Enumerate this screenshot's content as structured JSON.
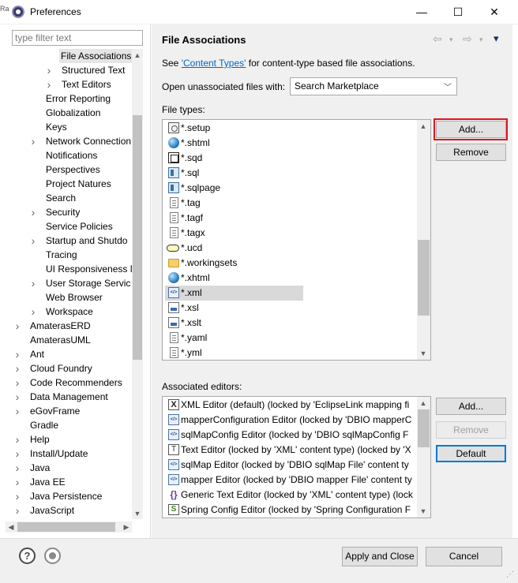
{
  "window": {
    "title": "Preferences",
    "edge_mark": "Ra",
    "minimize": "—",
    "maximize": "☐",
    "close": "✕"
  },
  "sidebar": {
    "filter_placeholder": "type filter text",
    "items": [
      {
        "label": "File Associations",
        "depth": 3,
        "twisty": "",
        "selected": true
      },
      {
        "label": "Structured Text",
        "depth": 2,
        "twisty": ">"
      },
      {
        "label": "Text Editors",
        "depth": 2,
        "twisty": ">"
      },
      {
        "label": "Error Reporting",
        "depth": 1,
        "twisty": ""
      },
      {
        "label": "Globalization",
        "depth": 1,
        "twisty": ""
      },
      {
        "label": "Keys",
        "depth": 1,
        "twisty": ""
      },
      {
        "label": "Network Connection",
        "depth": 1,
        "twisty": ">"
      },
      {
        "label": "Notifications",
        "depth": 1,
        "twisty": ""
      },
      {
        "label": "Perspectives",
        "depth": 1,
        "twisty": ""
      },
      {
        "label": "Project Natures",
        "depth": 1,
        "twisty": ""
      },
      {
        "label": "Search",
        "depth": 1,
        "twisty": ""
      },
      {
        "label": "Security",
        "depth": 1,
        "twisty": ">"
      },
      {
        "label": "Service Policies",
        "depth": 1,
        "twisty": ""
      },
      {
        "label": "Startup and Shutdo",
        "depth": 1,
        "twisty": ">"
      },
      {
        "label": "Tracing",
        "depth": 1,
        "twisty": ""
      },
      {
        "label": "UI Responsiveness M",
        "depth": 1,
        "twisty": ""
      },
      {
        "label": "User Storage Servic",
        "depth": 1,
        "twisty": ">"
      },
      {
        "label": "Web Browser",
        "depth": 1,
        "twisty": ""
      },
      {
        "label": "Workspace",
        "depth": 1,
        "twisty": ">"
      },
      {
        "label": "AmaterasERD",
        "depth": 0,
        "twisty": ">"
      },
      {
        "label": "AmaterasUML",
        "depth": 0,
        "twisty": ""
      },
      {
        "label": "Ant",
        "depth": 0,
        "twisty": ">"
      },
      {
        "label": "Cloud Foundry",
        "depth": 0,
        "twisty": ">"
      },
      {
        "label": "Code Recommenders",
        "depth": 0,
        "twisty": ">"
      },
      {
        "label": "Data Management",
        "depth": 0,
        "twisty": ">"
      },
      {
        "label": "eGovFrame",
        "depth": 0,
        "twisty": ">"
      },
      {
        "label": "Gradle",
        "depth": 0,
        "twisty": ""
      },
      {
        "label": "Help",
        "depth": 0,
        "twisty": ">"
      },
      {
        "label": "Install/Update",
        "depth": 0,
        "twisty": ">"
      },
      {
        "label": "Java",
        "depth": 0,
        "twisty": ">"
      },
      {
        "label": "Java EE",
        "depth": 0,
        "twisty": ">"
      },
      {
        "label": "Java Persistence",
        "depth": 0,
        "twisty": ">"
      },
      {
        "label": "JavaScript",
        "depth": 0,
        "twisty": ">"
      }
    ]
  },
  "page": {
    "title": "File Associations",
    "intro_prefix": "See ",
    "intro_link": "'Content Types'",
    "intro_suffix": " for content-type based file associations.",
    "open_label": "Open unassociated files with:",
    "open_value": "Search Marketplace",
    "file_types_label": "File types:",
    "file_types": [
      {
        "label": "*.setup",
        "icon": "setup"
      },
      {
        "label": "*.shtml",
        "icon": "globe"
      },
      {
        "label": "*.sqd",
        "icon": "sqd"
      },
      {
        "label": "*.sql",
        "icon": "sql"
      },
      {
        "label": "*.sqlpage",
        "icon": "sql"
      },
      {
        "label": "*.tag",
        "icon": "doc"
      },
      {
        "label": "*.tagf",
        "icon": "doc"
      },
      {
        "label": "*.tagx",
        "icon": "doc"
      },
      {
        "label": "*.ucd",
        "icon": "oval"
      },
      {
        "label": "*.workingsets",
        "icon": "folder"
      },
      {
        "label": "*.xhtml",
        "icon": "globe"
      },
      {
        "label": "*.xml",
        "icon": "xml",
        "selected": true
      },
      {
        "label": "*.xsl",
        "icon": "xsl"
      },
      {
        "label": "*.xslt",
        "icon": "xsl"
      },
      {
        "label": "*.yaml",
        "icon": "doc"
      },
      {
        "label": "*.yml",
        "icon": "doc"
      }
    ],
    "add_label": "Add...",
    "remove_label": "Remove",
    "associated_label": "Associated editors:",
    "editors": [
      {
        "label": "XML Editor (default) (locked by 'EclipseLink mapping fi",
        "icon": "x"
      },
      {
        "label": "mapperConfiguration Editor (locked by 'DBIO mapperC",
        "icon": "xml"
      },
      {
        "label": "sqlMapConfig Editor (locked by 'DBIO sqlMapConfig F",
        "icon": "xml"
      },
      {
        "label": "Text Editor (locked by 'XML' content type) (locked by 'X",
        "icon": "txt"
      },
      {
        "label": "sqlMap Editor (locked by 'DBIO sqlMap File' content ty",
        "icon": "xml"
      },
      {
        "label": "mapper Editor (locked by 'DBIO mapper File' content ty",
        "icon": "xml"
      },
      {
        "label": "Generic Text Editor (locked by 'XML' content type) (lock",
        "icon": "brace"
      },
      {
        "label": "Spring Config Editor (locked by 'Spring Configuration F",
        "icon": "spring"
      }
    ],
    "editors_add_label": "Add...",
    "editors_remove_label": "Remove",
    "default_label": "Default"
  },
  "footer": {
    "help": "?",
    "apply_close_label": "Apply and Close",
    "cancel_label": "Cancel"
  },
  "colors": {
    "accent": "#0078d7",
    "highlight": "#e0161c",
    "link": "#0066cc"
  },
  "icons": {
    "back": "⇦",
    "forward": "⇨",
    "menu": "▾"
  }
}
